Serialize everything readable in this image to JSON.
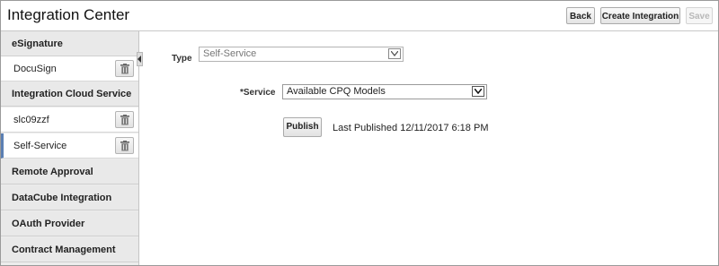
{
  "header": {
    "title": "Integration Center",
    "buttons": {
      "back": "Back",
      "create": "Create Integration",
      "save": "Save"
    }
  },
  "sidebar": {
    "groups": [
      {
        "label": "eSignature",
        "items": [
          {
            "label": "DocuSign",
            "selected": false
          }
        ]
      },
      {
        "label": "Integration Cloud Service",
        "items": [
          {
            "label": "slc09zzf",
            "selected": false
          },
          {
            "label": "Self-Service",
            "selected": true
          }
        ]
      },
      {
        "label": "Remote Approval",
        "items": []
      },
      {
        "label": "DataCube Integration",
        "items": []
      },
      {
        "label": "OAuth Provider",
        "items": []
      },
      {
        "label": "Contract Management",
        "items": []
      }
    ]
  },
  "form": {
    "type_label": "Type",
    "type_value": "Self-Service",
    "service_label": "*Service",
    "service_value": "Available CPQ Models",
    "publish_label": "Publish",
    "last_published": "Last Published 12/11/2017 6:18 PM"
  },
  "colors": {
    "selected_accent": "#5b7fb3",
    "sidebar_bg": "#ececec",
    "disabled_text": "#b8b8b8"
  }
}
